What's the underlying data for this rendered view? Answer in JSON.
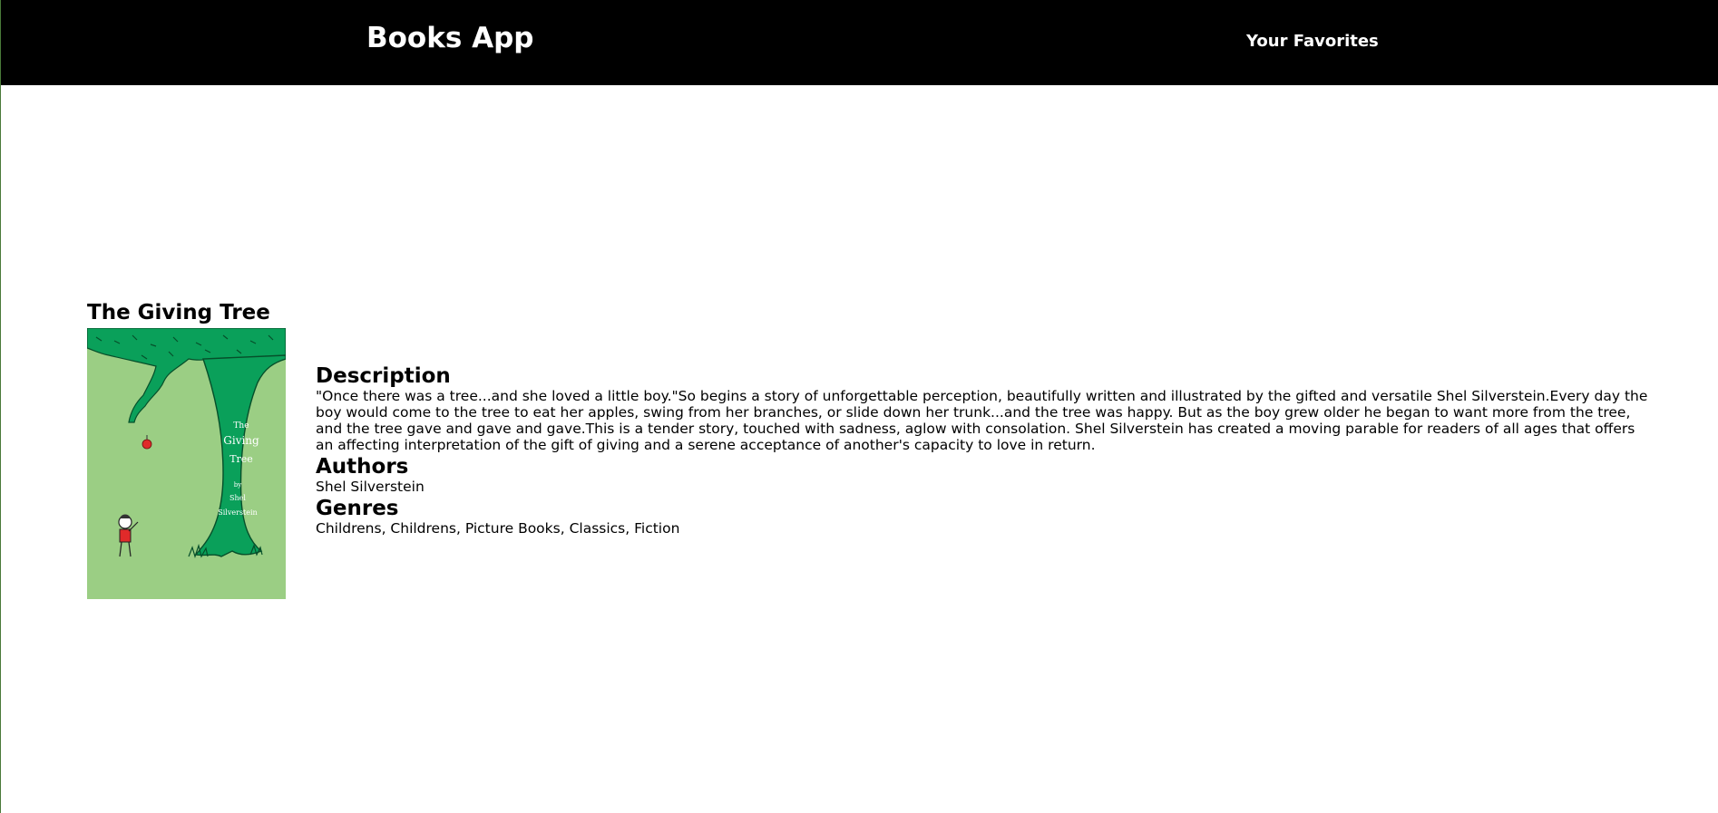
{
  "navbar": {
    "brand": "Books App",
    "favorites_link": "Your Favorites"
  },
  "book": {
    "title": "The Giving Tree",
    "cover": {
      "title_line1": "The",
      "title_line2": "Giving",
      "title_line3": "Tree",
      "by": "by",
      "author_line1": "Shel",
      "author_line2": "Silverstein"
    },
    "description_heading": "Description",
    "description": "\"Once there was a tree...and she loved a little boy.\"So begins a story of unforgettable perception, beautifully written and illustrated by the gifted and versatile Shel Silverstein.Every day the boy would come to the tree to eat her apples, swing from her branches, or slide down her trunk...and the tree was happy. But as the boy grew older he began to want more from the tree, and the tree gave and gave and gave.This is a tender story, touched with sadness, aglow with consolation. Shel Silverstein has created a moving parable for readers of all ages that offers an affecting interpretation of the gift of giving and a serene acceptance of another's capacity to love in return.",
    "authors_heading": "Authors",
    "authors": "Shel Silverstein",
    "genres_heading": "Genres",
    "genres": "Childrens, Childrens, Picture Books, Classics, Fiction"
  },
  "colors": {
    "navbar_bg": "#000000",
    "cover_bg": "#9bce84",
    "tree_green": "#0aa05a"
  }
}
